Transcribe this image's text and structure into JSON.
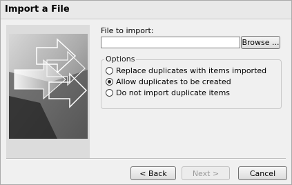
{
  "window": {
    "title": "Import a File"
  },
  "file": {
    "label": "File to import:",
    "value": "",
    "browse_label": "Browse ..."
  },
  "options": {
    "legend": "Options",
    "items": [
      {
        "label": "Replace duplicates with items imported",
        "selected": false
      },
      {
        "label": "Allow duplicates to be created",
        "selected": true
      },
      {
        "label": "Do not import duplicate items",
        "selected": false
      }
    ]
  },
  "buttons": {
    "back": "< Back",
    "next": "Next >",
    "cancel": "Cancel"
  }
}
